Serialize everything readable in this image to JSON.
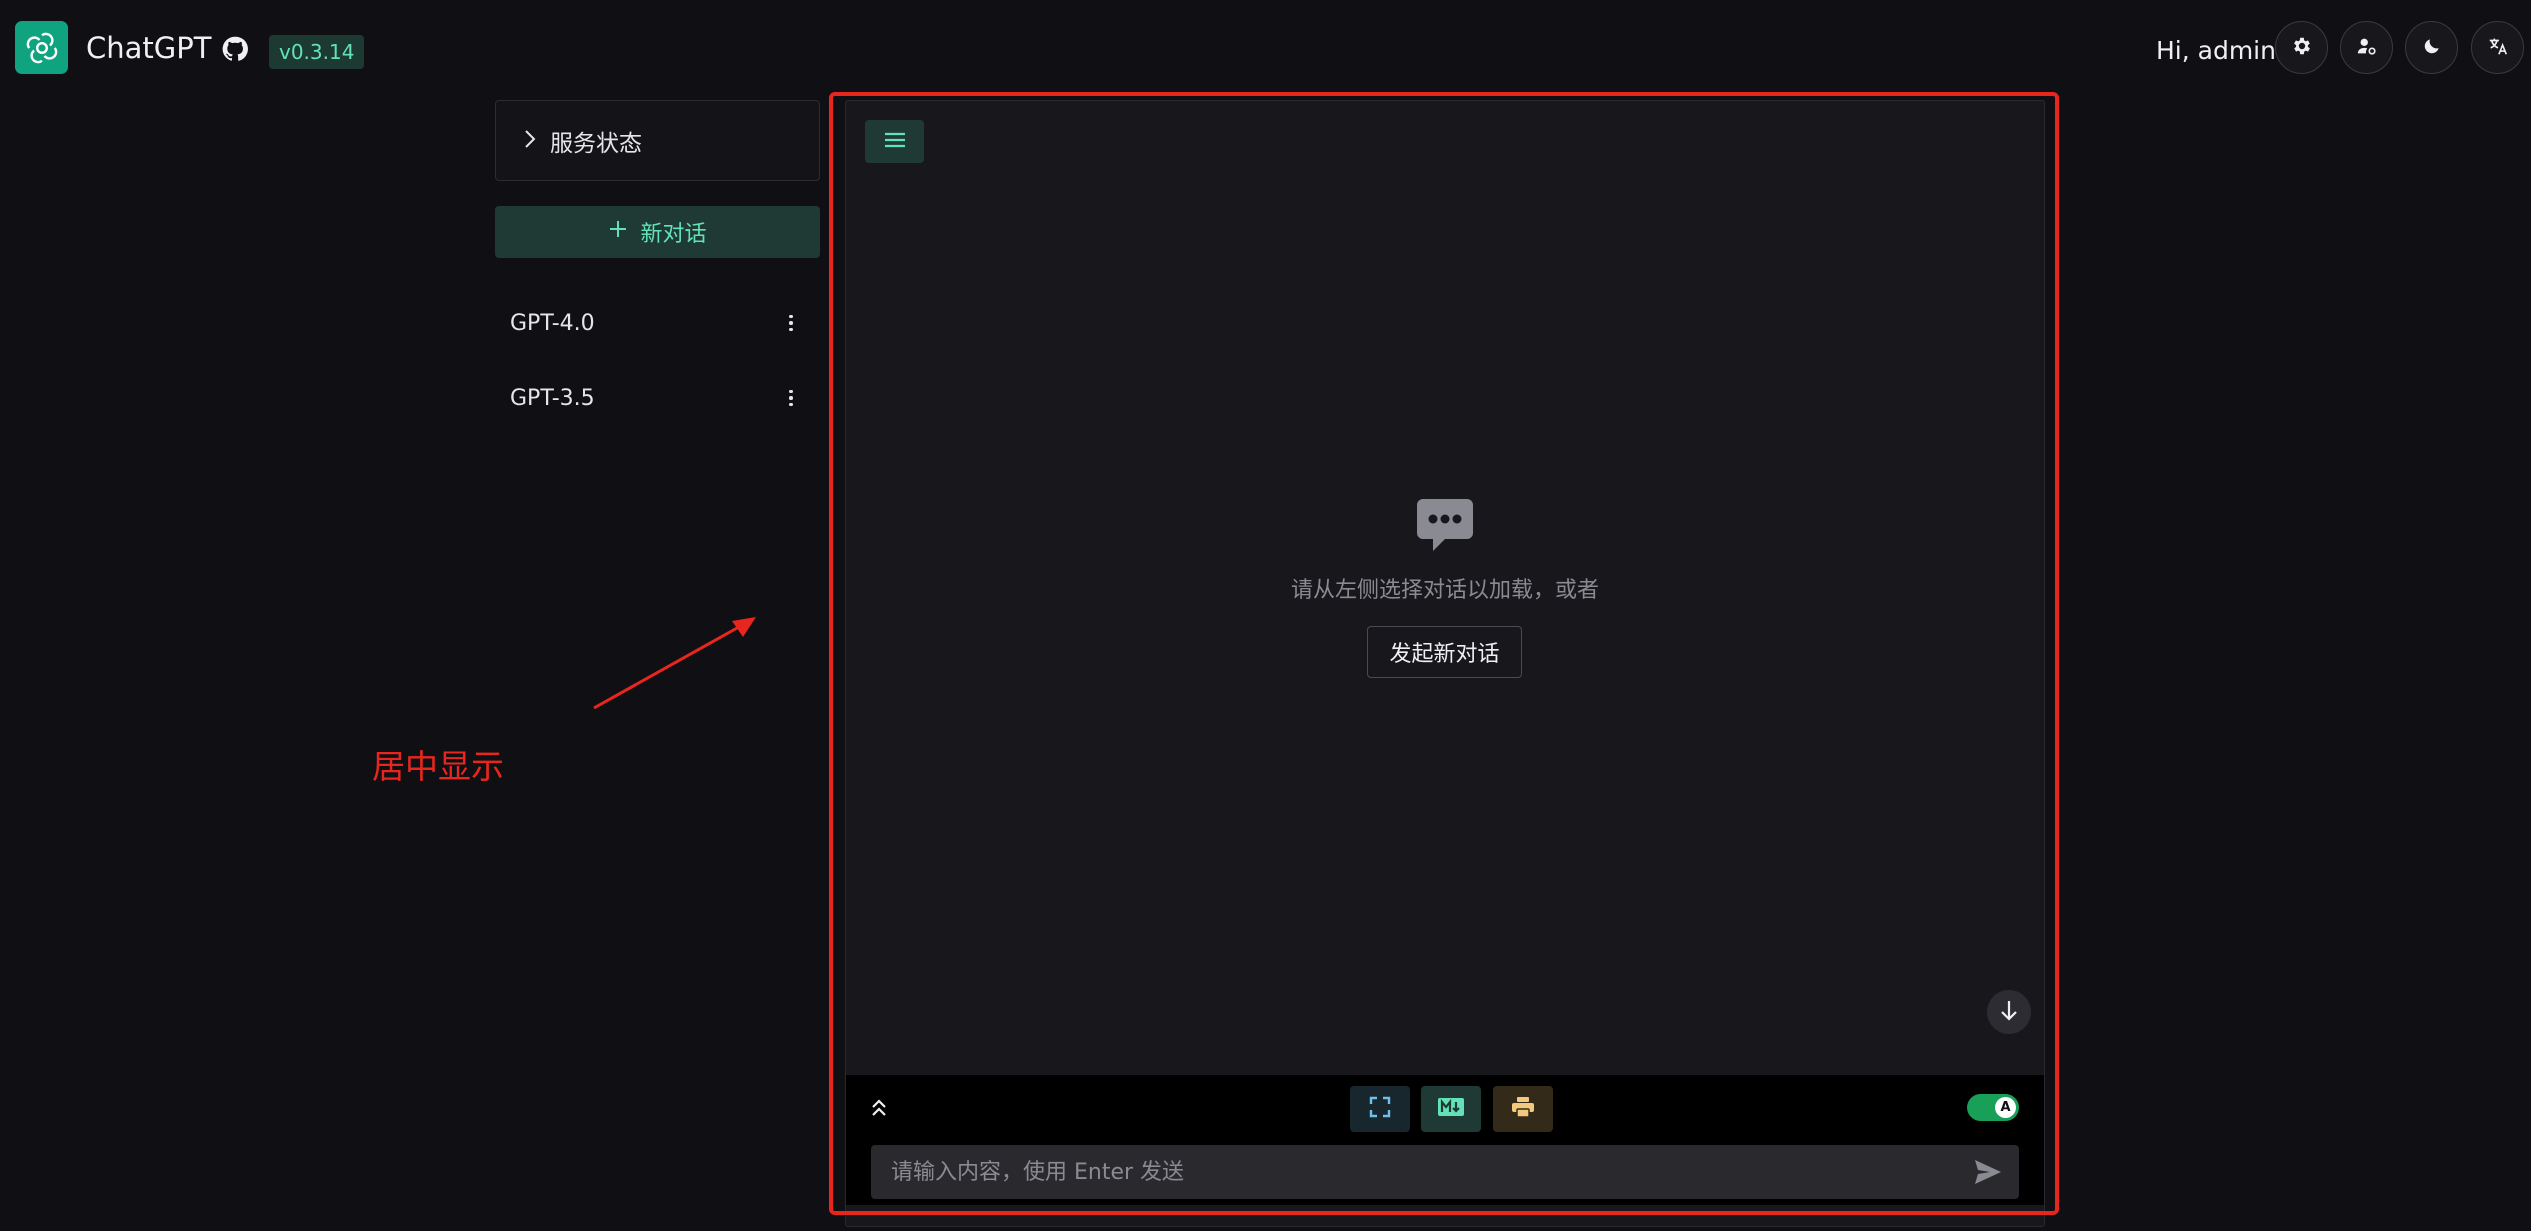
{
  "header": {
    "app_title": "ChatGPT",
    "version": "v0.3.14",
    "greeting": "Hi, admin",
    "buttons": [
      {
        "icon": "gear-icon"
      },
      {
        "icon": "user-settings-icon"
      },
      {
        "icon": "moon-icon"
      },
      {
        "icon": "translate-icon"
      }
    ]
  },
  "sidebar": {
    "service_status_label": "服务状态",
    "new_chat_label": "新对话",
    "chats": [
      {
        "name": "GPT-4.0"
      },
      {
        "name": "GPT-3.5"
      }
    ]
  },
  "annotation": {
    "text": "居中显示",
    "color": "#e8261e"
  },
  "main": {
    "empty_text": "请从左侧选择对话以加载，或者",
    "start_button_label": "发起新对话",
    "input_placeholder": "请输入内容，使用 Enter 发送",
    "input_value": "",
    "toggle_label": "A",
    "toggle_on": true
  },
  "colors": {
    "accent": "#63e2b7",
    "brand": "#10a37f",
    "highlight": "#e8261e",
    "background": "#101014"
  }
}
